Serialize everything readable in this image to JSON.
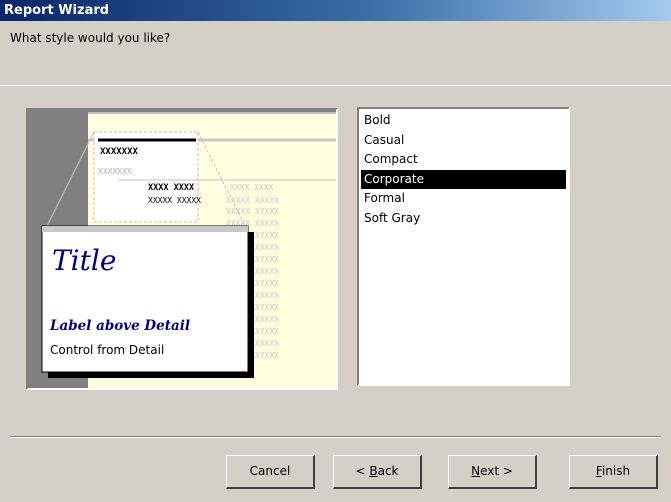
{
  "window": {
    "title": "Report Wizard"
  },
  "prompt": {
    "question": "What style would you like?"
  },
  "preview": {
    "placeholder_short": "XXXXXXX",
    "placeholder_faint": "XXXXXXX",
    "row_a": "XXXX XXXX",
    "row_b": "XXXXX XXXXX",
    "card_title": "Title",
    "card_label": "Label above Detail",
    "card_control": "Control from Detail"
  },
  "styles": {
    "items": [
      "Bold",
      "Casual",
      "Compact",
      "Corporate",
      "Formal",
      "Soft Gray"
    ],
    "selected": "Corporate"
  },
  "buttons": {
    "cancel": "Cancel",
    "back_prefix": "< ",
    "back_key": "B",
    "back_rest": "ack",
    "next_key": "N",
    "next_rest": "ext >",
    "finish_key": "F",
    "finish_rest": "inish"
  },
  "colors": {
    "titlebar_start": "#0a246a",
    "paper": "#ffffe0",
    "preview_bg": "#808080",
    "card_text": "#000080",
    "selection": "#000000"
  }
}
